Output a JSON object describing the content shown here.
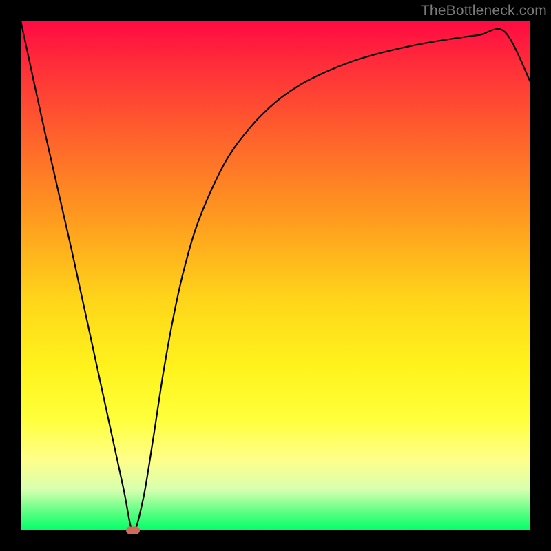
{
  "watermark": "TheBottleneck.com",
  "chart_data": {
    "type": "line",
    "title": "",
    "xlabel": "",
    "ylabel": "",
    "xlim": [
      0,
      100
    ],
    "ylim": [
      0,
      100
    ],
    "grid": false,
    "legend": false,
    "series": [
      {
        "name": "curve",
        "x": [
          0,
          5,
          10,
          15,
          20,
          22,
          24,
          26,
          28,
          30,
          32,
          35,
          40,
          45,
          50,
          55,
          60,
          65,
          70,
          75,
          80,
          85,
          90,
          95,
          100
        ],
        "y": [
          100,
          77,
          55,
          32,
          9,
          0,
          6,
          18,
          31,
          42,
          51,
          61,
          72,
          79,
          84,
          87.5,
          90,
          92,
          93.5,
          94.7,
          95.7,
          96.5,
          97.2,
          97.8,
          88.0
        ]
      }
    ],
    "marker": {
      "x": 22,
      "y": 0
    },
    "colors": {
      "curve": "#000000",
      "marker": "#d06a5a",
      "gradient_top": "#ff0a43",
      "gradient_bottom": "#00ff6a",
      "frame": "#000000"
    }
  }
}
